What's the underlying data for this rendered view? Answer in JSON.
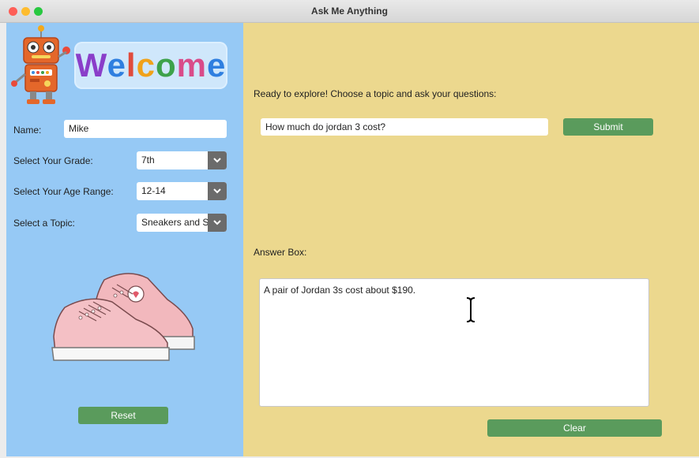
{
  "window": {
    "title": "Ask Me Anything"
  },
  "sidebar": {
    "welcome": "Welcome",
    "name_label": "Name:",
    "name_value": "Mike",
    "grade_label": "Select Your Grade:",
    "grade_value": "7th",
    "age_label": "Select Your Age Range:",
    "age_value": "12-14",
    "topic_label": "Select a Topic:",
    "topic_value": "Sneakers and S",
    "reset_label": "Reset"
  },
  "main": {
    "prompt": "Ready to explore! Choose a topic and ask your questions:",
    "question_value": "How much do jordan 3 cost?",
    "submit_label": "Submit",
    "answer_label": "Answer Box:",
    "answer_text": "A pair of Jordan 3s cost about $190.",
    "clear_label": "Clear"
  },
  "colors": {
    "sidebar_bg": "#96c9f5",
    "main_bg": "#ecd88e",
    "button": "#5a9b5c",
    "welcome_letters": [
      "#8a3ec9",
      "#2f7fe0",
      "#e04b3c",
      "#f0a21a",
      "#3da24a",
      "#d94b8a",
      "#2f7fe0"
    ]
  }
}
